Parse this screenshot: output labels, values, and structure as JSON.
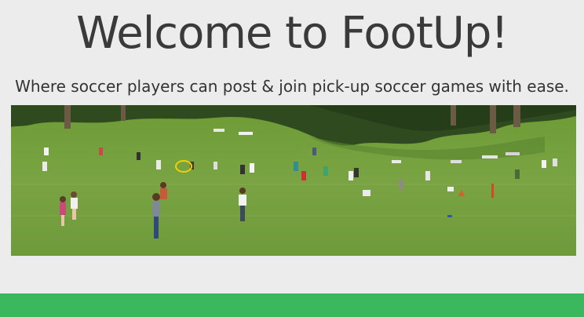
{
  "header": {
    "title": "Welcome to FootUp!",
    "subtitle": "Where soccer players can post & join pick-up soccer games with ease."
  },
  "colors": {
    "background": "#ececec",
    "footer_bar": "#3bb75e",
    "field_grass": "#6f9a3c",
    "trees": "#2f4a1f"
  }
}
